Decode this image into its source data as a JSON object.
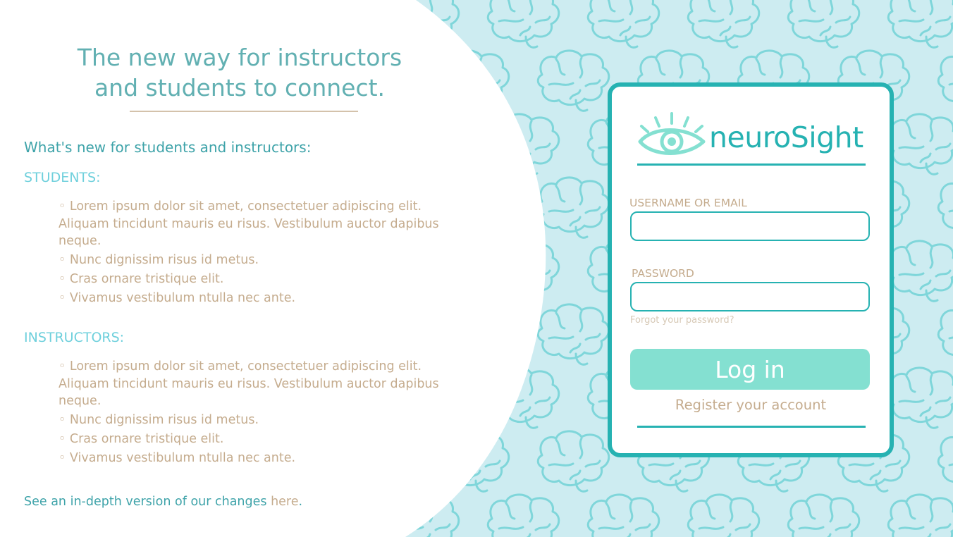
{
  "hero": {
    "tagline_line1": "The new way for instructors",
    "tagline_line2": "and students to connect."
  },
  "whats_new": {
    "heading": "What's new for students and instructors:",
    "students": {
      "title": "STUDENTS:",
      "items": [
        "◦ Lorem ipsum dolor sit amet, consectetuer adipiscing elit. Aliquam tincidunt mauris eu risus. Vestibulum auctor dapibus neque.",
        "◦ Nunc dignissim risus id metus.",
        "◦ Cras ornare tristique elit.",
        "◦ Vivamus vestibulum ntulla nec ante."
      ]
    },
    "instructors": {
      "title": "INSTRUCTORS:",
      "items": [
        "◦ Lorem ipsum dolor sit amet, consectetuer adipiscing elit. Aliquam tincidunt mauris eu risus. Vestibulum auctor dapibus neque.",
        "◦ Nunc dignissim risus id metus.",
        "◦ Cras ornare tristique elit.",
        "◦ Vivamus vestibulum ntulla nec ante."
      ]
    }
  },
  "footer": {
    "see_more_text": "See an in-depth version of our changes ",
    "see_more_link": "here",
    "see_more_suffix": "."
  },
  "login": {
    "brand_name": "neuroSight",
    "logo_icon": "eye-icon",
    "username_label": "USERNAME OR EMAIL",
    "username_value": "",
    "password_label": "PASSWORD",
    "password_value": "",
    "forgot_link": "Forgot your password?",
    "login_button": "Log in",
    "register_link": "Register your account"
  },
  "colors": {
    "teal": "#26b2b2",
    "mint_button": "#84e0d1",
    "tan_text": "#c5ac8e",
    "background": "#cdecf1",
    "brain_outline": "#7fd6da"
  }
}
